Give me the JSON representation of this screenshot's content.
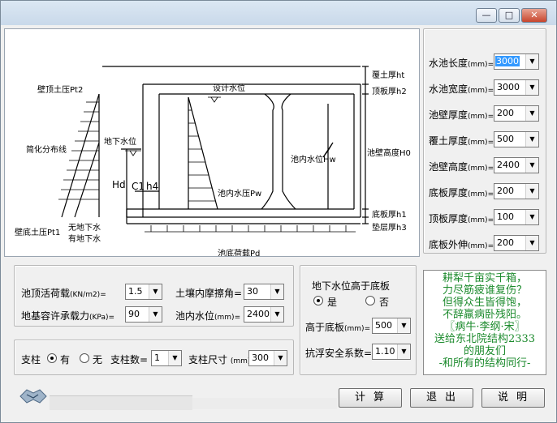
{
  "window": {
    "min_label": "—",
    "max_label": "□",
    "close_label": "✕"
  },
  "drawing": {
    "labels": {
      "wall_top_pressure": "壁顶土压Pt2",
      "simplified": "简化分布线",
      "ground_water": "地下水位",
      "design_water": "设计水位",
      "inner_pressure": "池内水压Pw",
      "inner_water": "池内水位Hw",
      "wall_bottom_pressure": "壁底土压Pt1",
      "no_water": "无地下水",
      "with_water": "有地下水",
      "bottom_load": "池底荷载Pd",
      "hd": "Hd",
      "c1": "C1",
      "h4": "h4",
      "soil_cover": "覆土厚ht",
      "top_slab": "顶板厚h2",
      "wall_height": "池壁高度H0",
      "bottom_slab": "底板厚h1",
      "cushion": "垫层厚h3"
    }
  },
  "params": [
    {
      "label": "水池长度",
      "unit": "(mm)=",
      "value": "3000",
      "selected": true
    },
    {
      "label": "水池宽度",
      "unit": "(mm)=",
      "value": "3000"
    },
    {
      "label": "池壁厚度",
      "unit": "(mm)=",
      "value": "200"
    },
    {
      "label": "覆土厚度",
      "unit": "(mm)=",
      "value": "500"
    },
    {
      "label": "池壁高度",
      "unit": "(mm)=",
      "value": "2400"
    },
    {
      "label": "底板厚度",
      "unit": "(mm)=",
      "value": "200"
    },
    {
      "label": "顶板厚度",
      "unit": "(mm)=",
      "value": "100"
    },
    {
      "label": "底板外伸",
      "unit": "(mm)=",
      "value": "200"
    }
  ],
  "loads": {
    "live_label": "池顶活荷载",
    "live_unit": "(KN/m2)=",
    "live_value": "1.5",
    "friction_label": "土壤内摩擦角=",
    "friction_value": "30",
    "bearing_label": "地基容许承载力",
    "bearing_unit": "(KPa)=",
    "bearing_value": "90",
    "water_label": "池内水位",
    "water_unit": "(mm)=",
    "water_value": "2400"
  },
  "column": {
    "label": "支柱",
    "yes": "有",
    "no": "无",
    "count_label": "支柱数=",
    "count_value": "1",
    "size_label": "支柱尺寸",
    "size_unit": "(mm)",
    "size_value": "300"
  },
  "groundwater": {
    "title": "地下水位高于底板",
    "yes": "是",
    "no": "否",
    "above_label": "高于底板",
    "above_unit": "(mm)=",
    "above_value": "500",
    "safety_label": "抗浮安全系数=",
    "safety_value": "1.10"
  },
  "poem": {
    "lines": [
      "耕犁千亩实千箱，",
      "力尽筋疲谁复伤？",
      "但得众生皆得饱，",
      "不辞羸病卧残阳。",
      "〖病牛·李纲·宋〗",
      "送给东北院结构2333",
      "的朋友们",
      "-和所有的结构同行-"
    ]
  },
  "buttons": {
    "calc": "计算",
    "exit": "退出",
    "help": "说明"
  }
}
